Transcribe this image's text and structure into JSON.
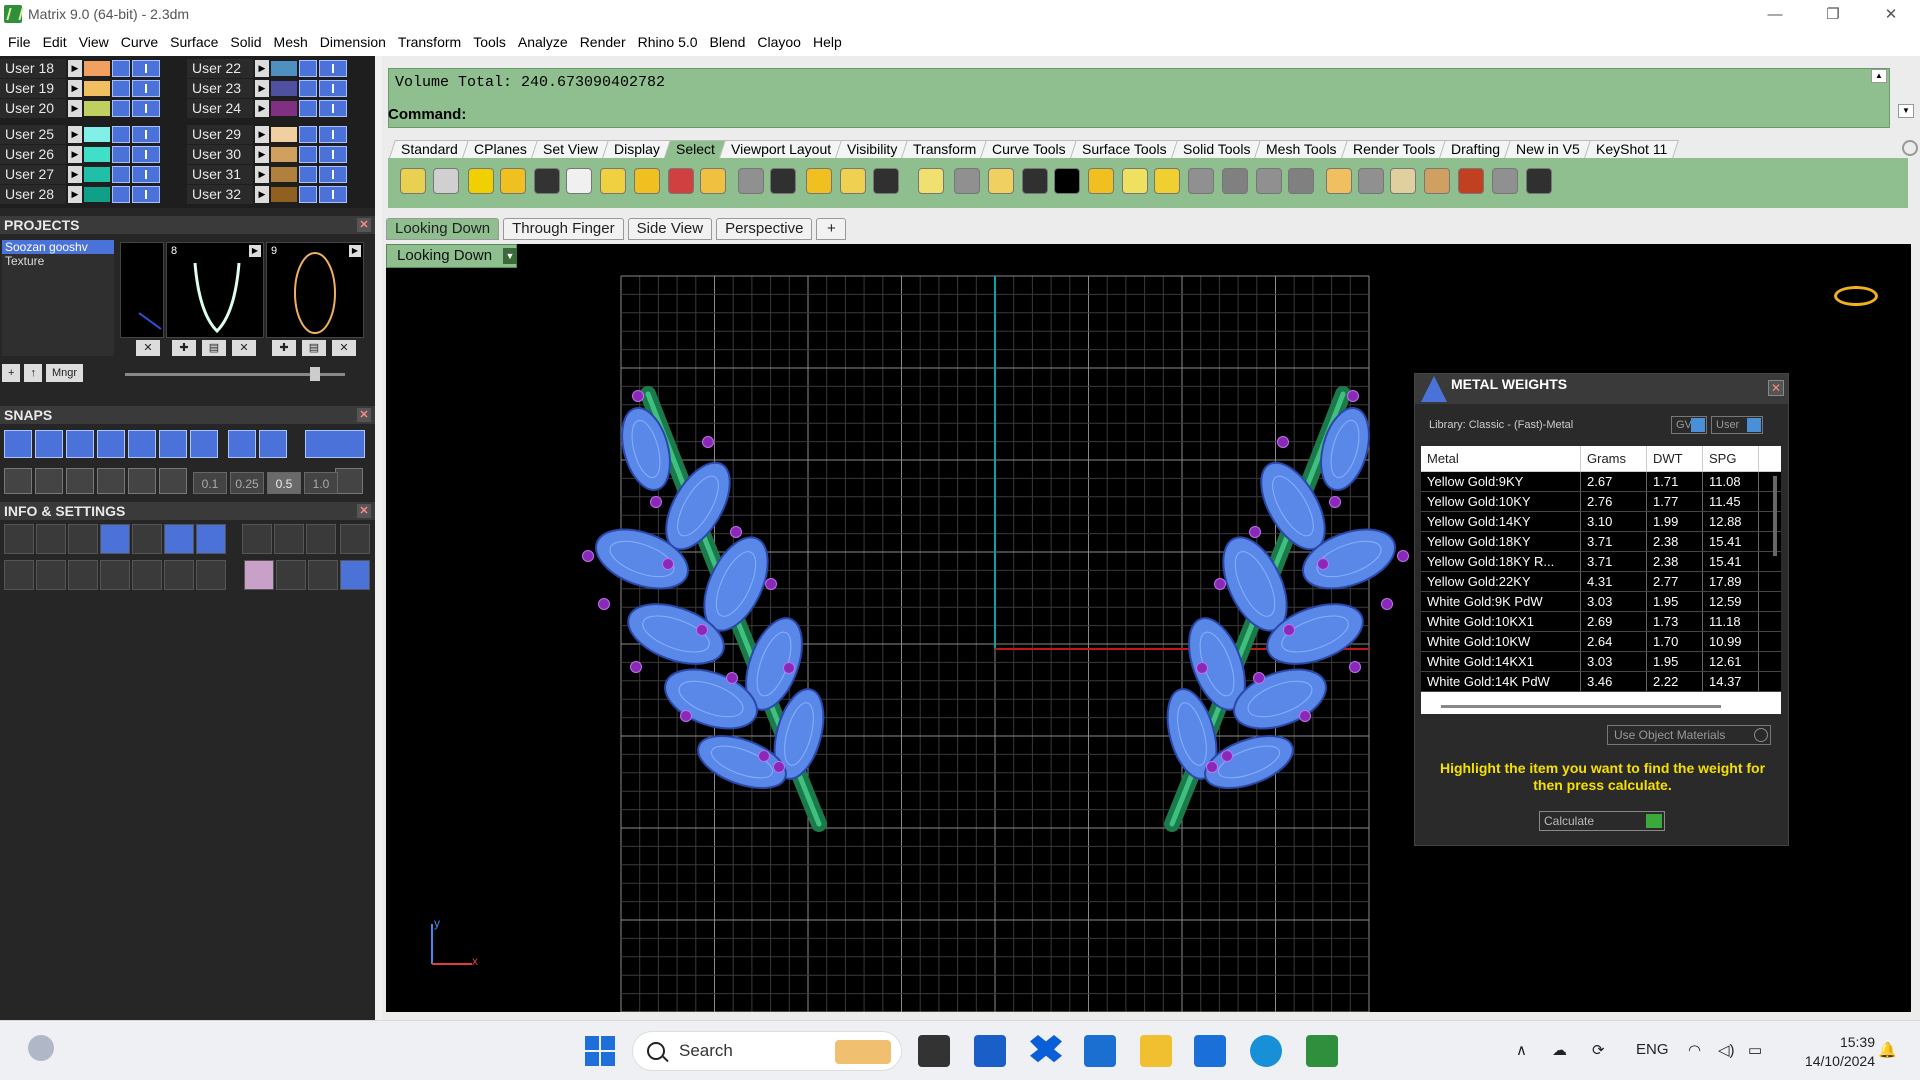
{
  "window": {
    "title": "Matrix 9.0 (64-bit) - 2.3dm",
    "controls": [
      "—",
      "❐",
      "✕"
    ]
  },
  "menu": [
    "File",
    "Edit",
    "View",
    "Curve",
    "Surface",
    "Solid",
    "Mesh",
    "Dimension",
    "Transform",
    "Tools",
    "Analyze",
    "Render",
    "Rhino 5.0",
    "Blend",
    "Clayoo",
    "Help"
  ],
  "layers": {
    "left": [
      {
        "name": "User 18",
        "color": "#f0a060"
      },
      {
        "name": "User 19",
        "color": "#f0c060"
      },
      {
        "name": "User 20",
        "color": "#c0d060"
      },
      {
        "name": "User 25",
        "color": "#80f0e8"
      },
      {
        "name": "User 26",
        "color": "#40e0c8"
      },
      {
        "name": "User 27",
        "color": "#20c0a8"
      },
      {
        "name": "User 28",
        "color": "#10a088"
      }
    ],
    "right": [
      {
        "name": "User 22",
        "color": "#5090c0"
      },
      {
        "name": "User 23",
        "color": "#5050a0"
      },
      {
        "name": "User 24",
        "color": "#803080"
      },
      {
        "name": "User 29",
        "color": "#f0d0a0"
      },
      {
        "name": "User 30",
        "color": "#d0a060"
      },
      {
        "name": "User 31",
        "color": "#b08040"
      },
      {
        "name": "User 32",
        "color": "#906020"
      }
    ]
  },
  "projects": {
    "header": "PROJECTS",
    "items": [
      "Soozan gooshv",
      "Texture"
    ],
    "thumb_nums": [
      "8",
      "9"
    ],
    "footer": [
      "+",
      "↑",
      "Mngr"
    ]
  },
  "snaps": {
    "header": "SNAPS",
    "values": [
      "0.1",
      "0.25",
      "0.5",
      "1.0"
    ]
  },
  "info": {
    "header": "INFO & SETTINGS"
  },
  "command": {
    "history": "Volume Total: 240.673090402782",
    "prompt": "Command:"
  },
  "toolbar_tabs": [
    "Standard",
    "CPlanes",
    "Set View",
    "Display",
    "Select",
    "Viewport Layout",
    "Visibility",
    "Transform",
    "Curve Tools",
    "Surface Tools",
    "Solid Tools",
    "Mesh Tools",
    "Render Tools",
    "Drafting",
    "New in V5",
    "KeyShot 11"
  ],
  "active_toolbar_tab": "Select",
  "view_tabs": [
    "Looking Down",
    "Through Finger",
    "Side View",
    "Perspective",
    "+"
  ],
  "viewport": {
    "label": "Looking Down",
    "axis_y": "y",
    "axis_x": "x"
  },
  "metal_weights": {
    "title": "METAL WEIGHTS",
    "library": "Library: Classic - (Fast)-Metal",
    "toggle_gv": "GV",
    "toggle_user": "User",
    "columns": [
      "Metal",
      "Grams",
      "DWT",
      "SPG"
    ],
    "rows": [
      [
        "Yellow Gold:9KY",
        "2.67",
        "1.71",
        "11.08"
      ],
      [
        "Yellow Gold:10KY",
        "2.76",
        "1.77",
        "11.45"
      ],
      [
        "Yellow Gold:14KY",
        "3.10",
        "1.99",
        "12.88"
      ],
      [
        "Yellow Gold:18KY",
        "3.71",
        "2.38",
        "15.41"
      ],
      [
        "Yellow Gold:18KY R...",
        "3.71",
        "2.38",
        "15.41"
      ],
      [
        "Yellow Gold:22KY",
        "4.31",
        "2.77",
        "17.89"
      ],
      [
        "White Gold:9K PdW",
        "3.03",
        "1.95",
        "12.59"
      ],
      [
        "White Gold:10KX1",
        "2.69",
        "1.73",
        "11.18"
      ],
      [
        "White Gold:10KW",
        "2.64",
        "1.70",
        "10.99"
      ],
      [
        "White Gold:14KX1",
        "3.03",
        "1.95",
        "12.61"
      ],
      [
        "White Gold:14K PdW",
        "3.46",
        "2.22",
        "14.37"
      ]
    ],
    "use_object_materials": "Use Object Materials",
    "hint": "Highlight the item you want to find the weight for then press calculate.",
    "calculate": "Calculate"
  },
  "taskbar": {
    "search_placeholder": "Search",
    "language": "ENG",
    "time": "15:39",
    "date": "14/10/2024"
  }
}
